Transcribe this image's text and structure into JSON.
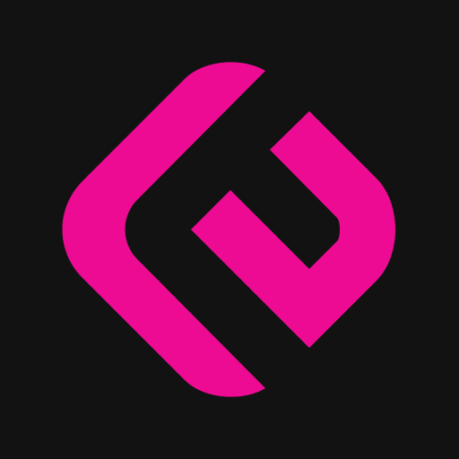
{
  "colors": {
    "background": "#121212",
    "accent": "#ed0b93"
  },
  "logo": {
    "icon": "brand-logo-icon"
  }
}
